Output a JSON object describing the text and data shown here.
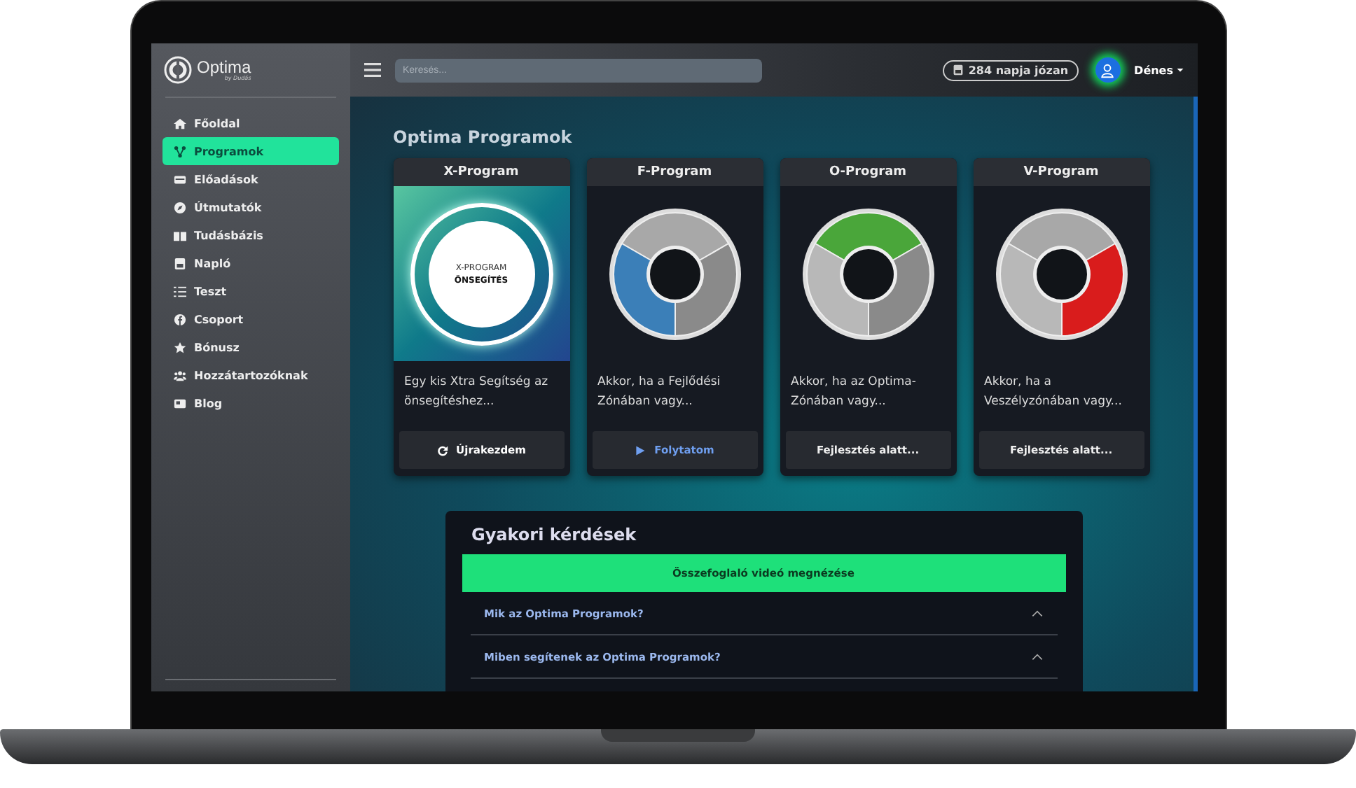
{
  "logo": {
    "name": "Optima",
    "tagline": "by Dudás"
  },
  "sidebar": {
    "items": [
      {
        "label": "Főoldal",
        "selected": false
      },
      {
        "label": "Programok",
        "selected": true
      },
      {
        "label": "Előadások",
        "selected": false
      },
      {
        "label": "Útmutatók",
        "selected": false
      },
      {
        "label": "Tudásbázis",
        "selected": false
      },
      {
        "label": "Napló",
        "selected": false
      },
      {
        "label": "Teszt",
        "selected": false
      },
      {
        "label": "Csoport",
        "selected": false
      },
      {
        "label": "Bónusz",
        "selected": false
      },
      {
        "label": "Hozzátartozóknak",
        "selected": false
      },
      {
        "label": "Blog",
        "selected": false
      }
    ]
  },
  "search": {
    "placeholder": "Keresés..."
  },
  "sober_badge": "284 napja józan",
  "user": {
    "name": "Dénes"
  },
  "page_title": "Optima Programok",
  "programs": [
    {
      "title": "X-Program",
      "kind": "badge",
      "image_text": [
        "X-PROGRAM",
        "ÖNSEGÍTÉS"
      ],
      "description": "Egy kis Xtra Segítség az önsegítéshez...",
      "button": {
        "label": "Újrakezdem",
        "kind": "restart"
      }
    },
    {
      "title": "F-Program",
      "kind": "left",
      "color": "#3b7fb8",
      "description": "Akkor, ha a Fejlődési Zónában vagy...",
      "button": {
        "label": "Folytatom",
        "kind": "continue"
      }
    },
    {
      "title": "O-Program",
      "kind": "top",
      "color": "#4aa63a",
      "description": "Akkor, ha az Optima-Zónában vagy...",
      "button": {
        "label": "Fejlesztés alatt...",
        "kind": "pending"
      }
    },
    {
      "title": "V-Program",
      "kind": "right",
      "color": "#d91c1c",
      "description": "Akkor, ha a Veszélyzónában vagy...",
      "button": {
        "label": "Fejlesztés alatt...",
        "kind": "pending"
      }
    }
  ],
  "faq": {
    "title": "Gyakori kérdések",
    "video_button": "Összefoglaló videó megnézése",
    "questions": [
      "Mik az Optima Programok?",
      "Miben segítenek az Optima Programok?"
    ]
  }
}
